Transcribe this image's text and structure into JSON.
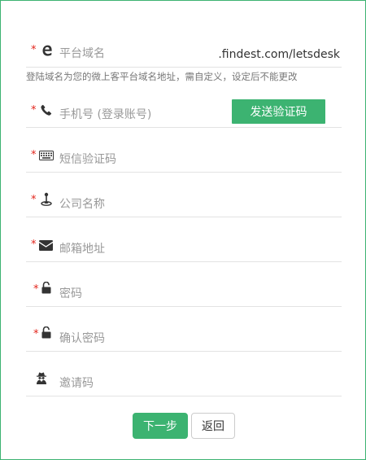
{
  "form": {
    "domain": {
      "required_mark": "*",
      "icon": "edge-e-icon",
      "placeholder": "平台域名",
      "suffix": ".findest.com/letsdesk",
      "hint": "登陆域名为您的微上客平台域名地址，需自定义，设定后不能更改"
    },
    "phone": {
      "required_mark": "*",
      "icon": "phone-icon",
      "placeholder": "手机号 (登录账号)",
      "send_code_label": "发送验证码"
    },
    "sms_code": {
      "required_mark": "*",
      "icon": "keyboard-icon",
      "placeholder": "短信验证码"
    },
    "company": {
      "required_mark": "*",
      "icon": "map-marker-icon",
      "placeholder": "公司名称"
    },
    "email": {
      "required_mark": "*",
      "icon": "envelope-icon",
      "placeholder": "邮箱地址"
    },
    "password": {
      "required_mark": "*",
      "icon": "unlock-icon",
      "placeholder": "密码"
    },
    "confirm_password": {
      "required_mark": "*",
      "icon": "unlock-icon",
      "placeholder": "确认密码"
    },
    "invite_code": {
      "icon": "spy-user-icon",
      "placeholder": "邀请码"
    }
  },
  "actions": {
    "next_label": "下一步",
    "back_label": "返回"
  },
  "colors": {
    "accent": "#3cb371",
    "required": "#e2231a",
    "border": "#3cb371",
    "divider": "#e3e3e3"
  }
}
